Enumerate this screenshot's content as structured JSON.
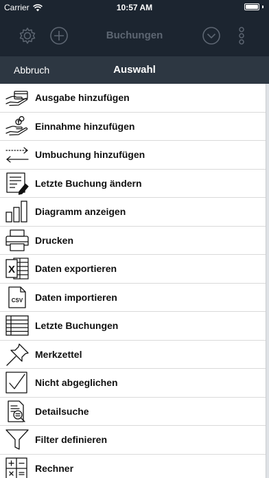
{
  "status_bar": {
    "carrier": "Carrier",
    "time": "10:57 AM"
  },
  "nav_bar": {
    "title": "Buchungen",
    "icons": [
      "gear-icon",
      "plus-circle-icon",
      "chevron-down-circle-icon",
      "more-vertical-icon"
    ]
  },
  "menu": {
    "cancel_label": "Abbruch",
    "title": "Auswahl",
    "items": [
      {
        "label": "Ausgabe hinzufügen",
        "icon": "hand-card-icon"
      },
      {
        "label": "Einnahme hinzufügen",
        "icon": "hand-coins-icon"
      },
      {
        "label": "Umbuchung hinzufügen",
        "icon": "transfer-arrows-icon"
      },
      {
        "label": "Letzte Buchung ändern",
        "icon": "edit-document-icon"
      },
      {
        "label": "Diagramm anzeigen",
        "icon": "bar-chart-icon"
      },
      {
        "label": "Drucken",
        "icon": "printer-icon"
      },
      {
        "label": "Daten exportieren",
        "icon": "excel-export-icon"
      },
      {
        "label": "Daten importieren",
        "icon": "csv-file-icon"
      },
      {
        "label": "Letzte Buchungen",
        "icon": "list-table-icon"
      },
      {
        "label": "Merkzettel",
        "icon": "pushpin-icon"
      },
      {
        "label": "Nicht abgeglichen",
        "icon": "checkbox-check-icon"
      },
      {
        "label": "Detailsuche",
        "icon": "document-search-icon"
      },
      {
        "label": "Filter definieren",
        "icon": "funnel-icon"
      },
      {
        "label": "Rechner",
        "icon": "calculator-icon"
      }
    ],
    "csv_icon_text": "CSV",
    "excel_icon_text": "X"
  },
  "colors": {
    "nav_background": "#1c2530",
    "menu_header": "#2d3742",
    "nav_title_dim": "#5d6672",
    "text": "#111111"
  }
}
